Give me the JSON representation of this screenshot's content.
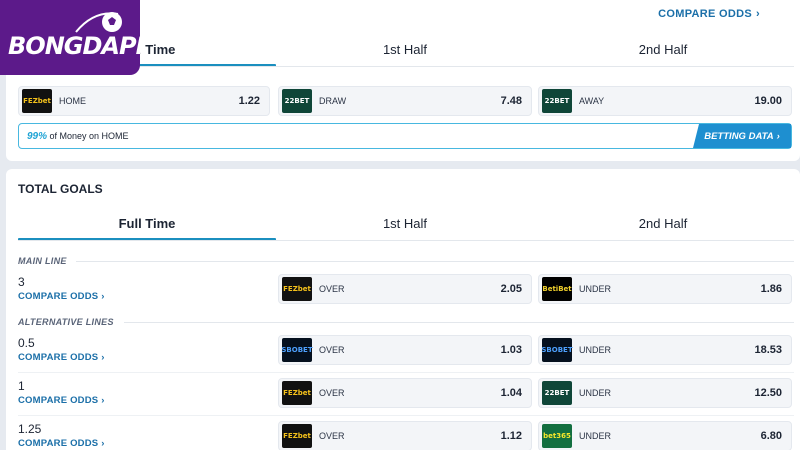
{
  "logo": {
    "text": "BONGDAPI"
  },
  "top": {
    "compare_odds": "COMPARE ODDS",
    "tabs": [
      "Full Time",
      "1st Half",
      "2nd Half"
    ],
    "odds": [
      {
        "bookmaker": "FEZbet",
        "label": "HOME",
        "value": "1.22"
      },
      {
        "bookmaker": "22BET",
        "label": "DRAW",
        "value": "7.48"
      },
      {
        "bookmaker": "22BET",
        "label": "AWAY",
        "value": "19.00"
      }
    ],
    "money": {
      "pct": "99%",
      "text": " of Money on HOME",
      "button": "BETTING DATA"
    }
  },
  "total_goals": {
    "title": "TOTAL GOALS",
    "tabs": [
      "Full Time",
      "1st Half",
      "2nd Half"
    ],
    "main_line_label": "MAIN LINE",
    "alt_lines_label": "ALTERNATIVE LINES",
    "compare_odds": "COMPARE ODDS",
    "rows": [
      {
        "line": "3",
        "over_bookmaker": "FEZbet",
        "over_label": "OVER",
        "over_value": "2.05",
        "under_bookmaker": "BetiBet",
        "under_label": "UNDER",
        "under_value": "1.86"
      },
      {
        "line": "0.5",
        "over_bookmaker": "SBOBET",
        "over_label": "OVER",
        "over_value": "1.03",
        "under_bookmaker": "SBOBET",
        "under_label": "UNDER",
        "under_value": "18.53"
      },
      {
        "line": "1",
        "over_bookmaker": "FEZbet",
        "over_label": "OVER",
        "over_value": "1.04",
        "under_bookmaker": "22BET",
        "under_label": "UNDER",
        "under_value": "12.50"
      },
      {
        "line": "1.25",
        "over_bookmaker": "FEZbet",
        "over_label": "OVER",
        "over_value": "1.12",
        "under_bookmaker": "bet365",
        "under_label": "UNDER",
        "under_value": "6.80"
      }
    ]
  },
  "colors": {
    "accent": "#1b8fbf",
    "link": "#1b6fa8",
    "logo_bg": "#5c1a8a",
    "button": "#1e8fd0"
  }
}
